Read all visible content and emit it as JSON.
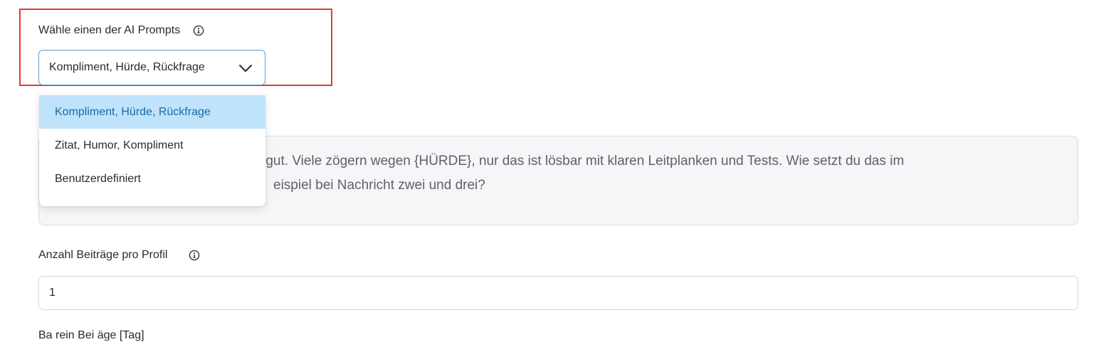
{
  "prompt_section": {
    "label": "Wähle einen der AI Prompts",
    "info_icon": "info-icon",
    "selected_value": "Kompliment, Hürde, Rückfrage",
    "chevron_icon": "chevron-down-icon",
    "options": [
      {
        "label": "Kompliment, Hürde, Rückfrage",
        "selected": true
      },
      {
        "label": "Zitat, Humor, Kompliment",
        "selected": false
      },
      {
        "label": "Benutzerdefiniert",
        "selected": false
      }
    ]
  },
  "prompt_text": {
    "line1": "es gut. Viele zögern wegen {HÜRDE}, nur das ist lösbar mit klaren Leitplanken und Tests. Wie setzt du das im",
    "line2": "eispiel bei Nachricht zwei und drei?"
  },
  "posts_per_profile": {
    "label": "Anzahl Beiträge pro Profil",
    "info_icon": "info-icon",
    "value": "1"
  },
  "next_section": {
    "label": "Ba rein Bei äge [Tag]"
  },
  "colors": {
    "highlight_border": "#e53935",
    "select_border": "#5aa0d8",
    "selected_option_bg": "#bfe3fb",
    "selected_option_text": "#1c6aa0",
    "textarea_bg": "#f5f6f8"
  }
}
